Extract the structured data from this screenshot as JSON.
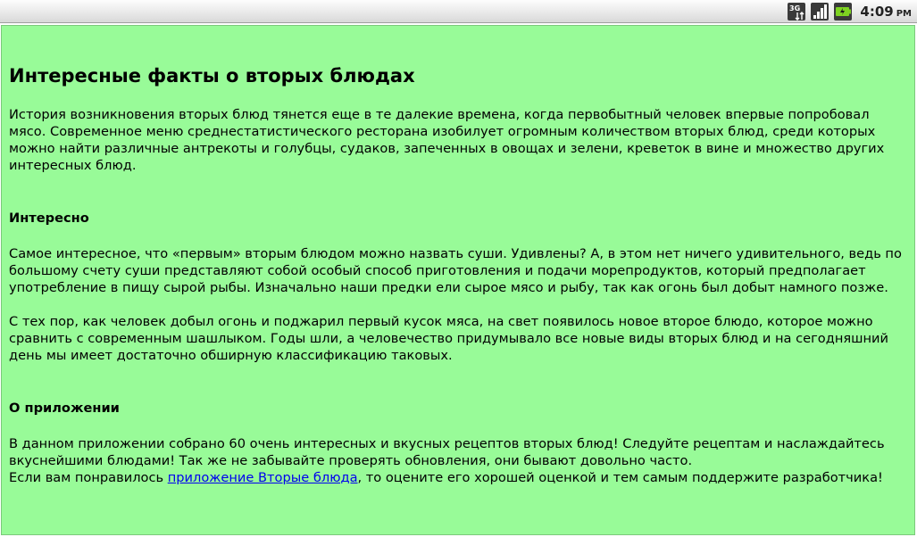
{
  "status_bar": {
    "time": "4:09",
    "ampm": "PM",
    "icons": [
      "3g-data-icon",
      "signal-strength-icon",
      "battery-charging-icon"
    ]
  },
  "article": {
    "title": "Интересные факты о вторых блюдах",
    "intro": "История возникновения вторых блюд тянется еще в те далекие времена, когда первобытный человек впервые попробовал мясо. Современное меню среднестатистического ресторана изобилует огромным количеством вторых блюд, среди которых можно найти различные антрекоты и голубцы, судаков, запеченных в овощах и зелени, креветок в вине и множество других интересных блюд.",
    "interesting_heading": "Интересно",
    "interesting_p1": "Самое интересное, что «первым» вторым блюдом можно назвать суши. Удивлены? А, в этом нет ничего удивительного, ведь по большому счету суши представляют собой особый способ приготовления и подачи морепродуктов, который предполагает употребление в пищу сырой рыбы. Изначально наши предки ели сырое мясо и рыбу, так как огонь был добыт намного позже.",
    "interesting_p2": "С тех пор, как человек добыл огонь и поджарил первый кусок мяса, на свет появилось новое второе блюдо, которое можно сравнить с современным шашлыком. Годы шли, а человечество придумывало все новые виды вторых блюд и на сегодняшний день мы имеет достаточно обширную классификацию таковых.",
    "about_heading": "О приложении",
    "about_p1": "В данном приложении собрано 60 очень интересных и вкусных рецептов вторых блюд! Следуйте рецептам и наслаждайтесь вкуснейшими блюдами! Так же не забывайте проверять обновления, они бывают довольно часто.",
    "about_p2_before": "Если вам понравилось ",
    "about_p2_link": "приложение Вторые блюда",
    "about_p2_after": ", то оцените его хорошей оценкой и тем самым поддержите разработчика!"
  },
  "colors": {
    "page_background": "#98fb98",
    "link": "#0000ee",
    "text": "#000000"
  }
}
